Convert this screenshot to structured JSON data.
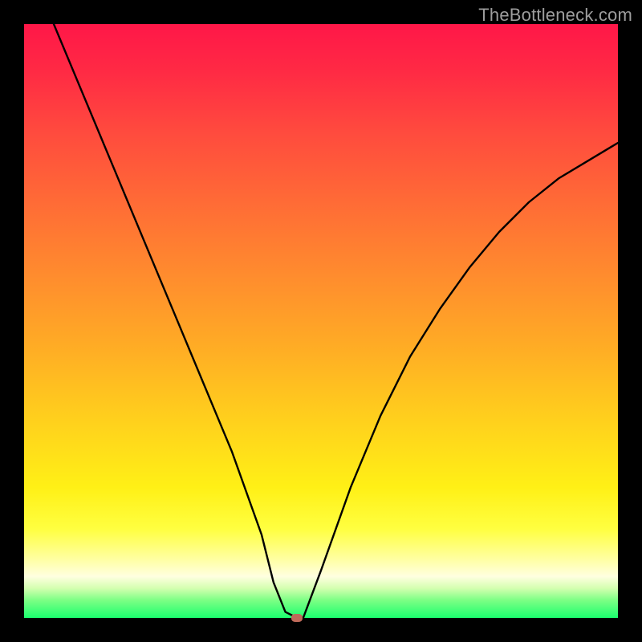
{
  "watermark": "TheBottleneck.com",
  "chart_data": {
    "type": "line",
    "title": "",
    "xlabel": "",
    "ylabel": "",
    "xlim": [
      0,
      100
    ],
    "ylim": [
      0,
      100
    ],
    "grid": false,
    "series": [
      {
        "name": "curve",
        "x": [
          5,
          10,
          15,
          20,
          25,
          30,
          35,
          40,
          42,
          44,
          46,
          47,
          50,
          55,
          60,
          65,
          70,
          75,
          80,
          85,
          90,
          95,
          100
        ],
        "y": [
          100,
          88,
          76,
          64,
          52,
          40,
          28,
          14,
          6,
          1,
          0,
          0,
          8,
          22,
          34,
          44,
          52,
          59,
          65,
          70,
          74,
          77,
          80
        ]
      }
    ],
    "marker": {
      "x": 46,
      "y": 0,
      "color": "#c06a5a"
    },
    "background_gradient": [
      "#ff1748",
      "#fff016",
      "#1bff6e"
    ]
  }
}
